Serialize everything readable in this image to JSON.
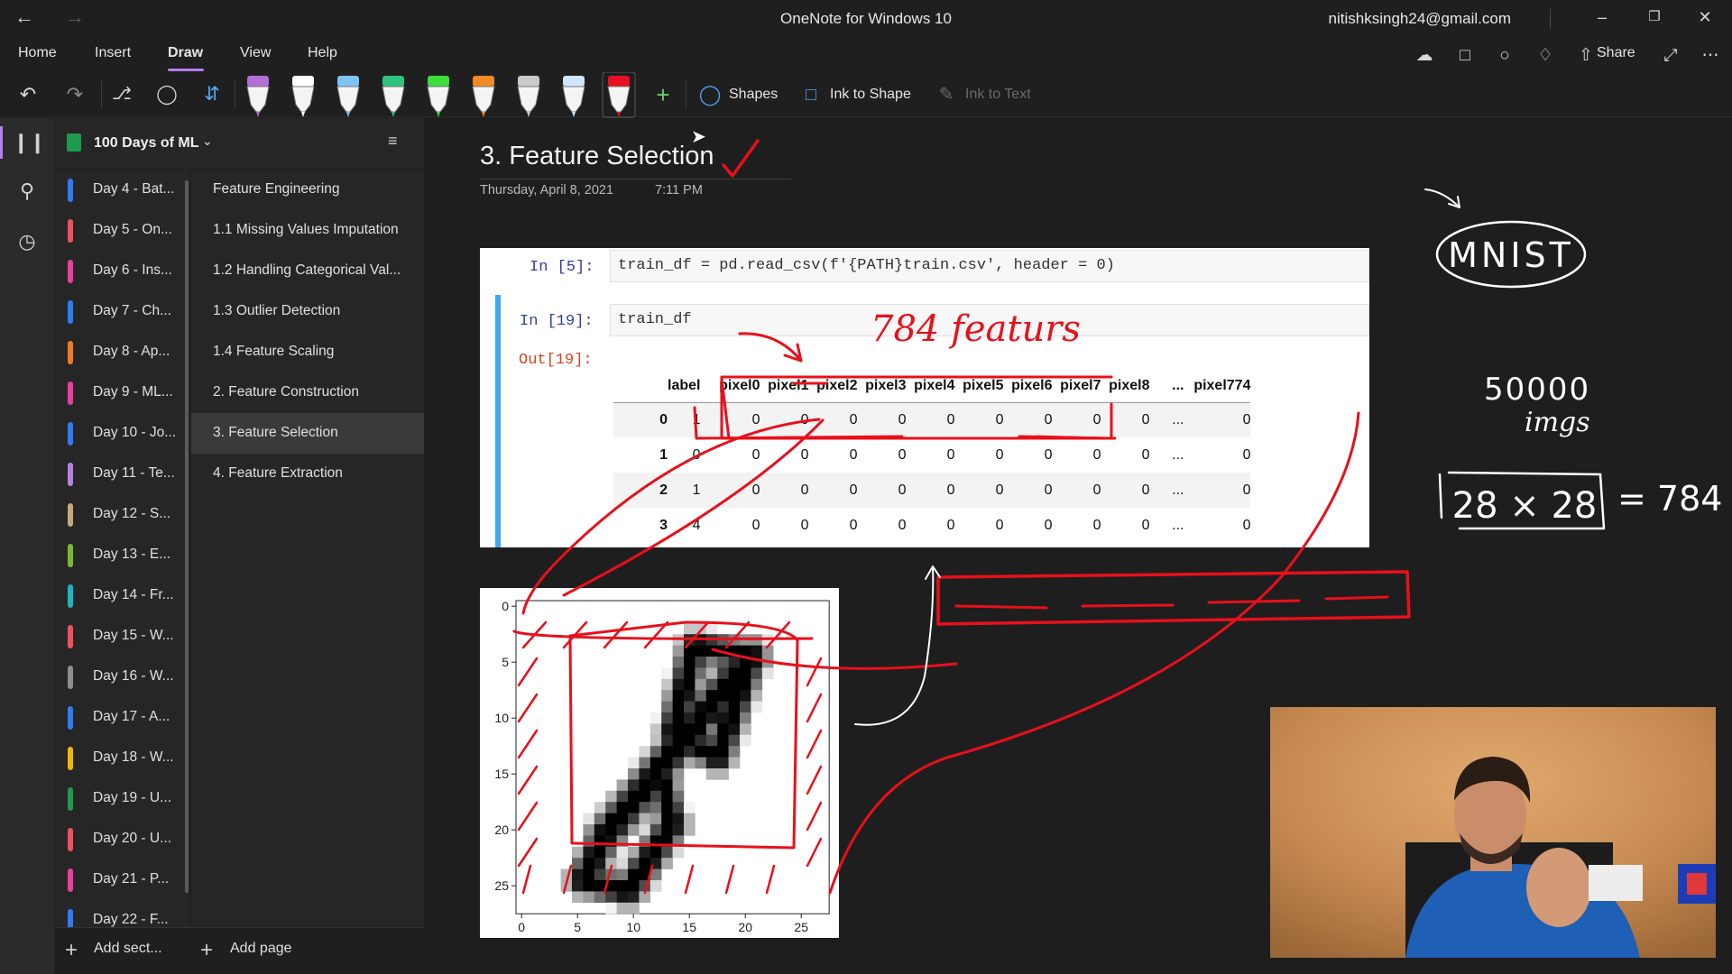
{
  "app": {
    "title": "OneNote for Windows 10",
    "account": "nitishksingh24@gmail.com"
  },
  "menu": {
    "tabs": [
      "Home",
      "Insert",
      "Draw",
      "View",
      "Help"
    ],
    "active_tab": "Draw",
    "share_label": "Share"
  },
  "toolbar": {
    "shapes_label": "Shapes",
    "ink_to_shape_label": "Ink to Shape",
    "ink_to_text_label": "Ink to Text",
    "pens": [
      {
        "name": "highlighter-purple",
        "color": "#b46fd6"
      },
      {
        "name": "pen-white",
        "color": "#ffffff"
      },
      {
        "name": "pen-light-blue",
        "color": "#7fc3f5"
      },
      {
        "name": "pen-green",
        "color": "#2ec27e"
      },
      {
        "name": "highlighter-green",
        "color": "#3ddc3d"
      },
      {
        "name": "pen-orange",
        "color": "#f08a24"
      },
      {
        "name": "pen-gray",
        "color": "#c9c9c9"
      },
      {
        "name": "pen-blue-white",
        "color": "#cfe6ff"
      },
      {
        "name": "pen-red",
        "color": "#e81123"
      }
    ]
  },
  "notebook": {
    "name": "100 Days of ML",
    "color": "#1e9a4c"
  },
  "sections": [
    {
      "label": "Day 4 - Bat...",
      "color": "#2d7df6"
    },
    {
      "label": "Day 5 - On...",
      "color": "#f0525b"
    },
    {
      "label": "Day 6 - Ins...",
      "color": "#ea3fa0"
    },
    {
      "label": "Day 7 - Ch...",
      "color": "#2d7df6"
    },
    {
      "label": "Day 8 - Ap...",
      "color": "#f07c24"
    },
    {
      "label": "Day 9 - ML...",
      "color": "#ea3fa0"
    },
    {
      "label": "Day 10 - Jo...",
      "color": "#2d7df6"
    },
    {
      "label": "Day 11 - Te...",
      "color": "#b77fe0"
    },
    {
      "label": "Day 12 - S...",
      "color": "#c8a878"
    },
    {
      "label": "Day 13 - E...",
      "color": "#7cb82f"
    },
    {
      "label": "Day 14 - Fr...",
      "color": "#19b6c4"
    },
    {
      "label": "Day 15 - W...",
      "color": "#f0525b"
    },
    {
      "label": "Day 16 - W...",
      "color": "#8f8f8f"
    },
    {
      "label": "Day 17 - A...",
      "color": "#2d7df6"
    },
    {
      "label": "Day 18 - W...",
      "color": "#f4b400"
    },
    {
      "label": "Day 19 - U...",
      "color": "#1e9a4c"
    },
    {
      "label": "Day 20 - U...",
      "color": "#f0525b"
    },
    {
      "label": "Day 21 - P...",
      "color": "#ea3fa0"
    },
    {
      "label": "Day 22 - F...",
      "color": "#2d7df6"
    }
  ],
  "pages": [
    {
      "label": "Feature Engineering"
    },
    {
      "label": "1.1 Missing Values Imputation"
    },
    {
      "label": "1.2 Handling Categorical Val..."
    },
    {
      "label": "1.3 Outlier Detection"
    },
    {
      "label": "1.4 Feature Scaling"
    },
    {
      "label": "2. Feature Construction"
    },
    {
      "label": "3. Feature Selection",
      "active": true
    },
    {
      "label": "4. Feature Extraction"
    }
  ],
  "add": {
    "section_label": "Add sect...",
    "page_label": "Add page"
  },
  "page": {
    "title": "3. Feature Selection",
    "date": "Thursday, April 8, 2021",
    "time": "7:11 PM"
  },
  "notebook_shot": {
    "in5_prompt": "In [5]:",
    "in5_code": "train_df = pd.read_csv(f'{PATH}train.csv', header = 0)",
    "in19_prompt": "In [19]:",
    "in19_code": "train_df",
    "out19_prompt": "Out[19]:",
    "columns": [
      "",
      "label",
      "pixel0",
      "pixel1",
      "pixel2",
      "pixel3",
      "pixel4",
      "pixel5",
      "pixel6",
      "pixel7",
      "pixel8",
      "...",
      "pixel774"
    ],
    "rows": [
      [
        "0",
        "1",
        "0",
        "0",
        "0",
        "0",
        "0",
        "0",
        "0",
        "0",
        "0",
        "...",
        "0"
      ],
      [
        "1",
        "0",
        "0",
        "0",
        "0",
        "0",
        "0",
        "0",
        "0",
        "0",
        "0",
        "...",
        "0"
      ],
      [
        "2",
        "1",
        "0",
        "0",
        "0",
        "0",
        "0",
        "0",
        "0",
        "0",
        "0",
        "...",
        "0"
      ],
      [
        "3",
        "4",
        "0",
        "0",
        "0",
        "0",
        "0",
        "0",
        "0",
        "0",
        "0",
        "...",
        "0"
      ]
    ]
  },
  "digit_plot": {
    "x_ticks": [
      "0",
      "5",
      "10",
      "15",
      "20",
      "25"
    ],
    "y_ticks": [
      "0",
      "5",
      "10",
      "15",
      "20",
      "25"
    ]
  },
  "ink_notes": {
    "features": "784 featurs",
    "dataset": "MNIST",
    "count": "50000",
    "count_unit": "imgs",
    "dims": "28 × 28",
    "equals": "= 784"
  }
}
